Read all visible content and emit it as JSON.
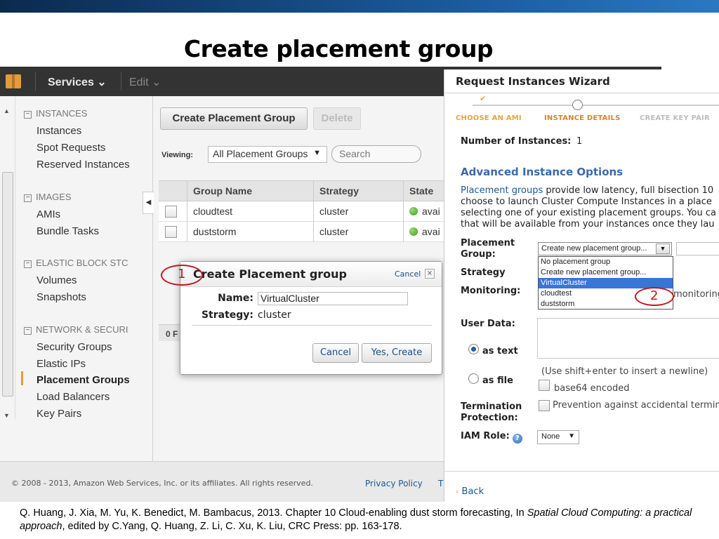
{
  "slide": {
    "title": "Create placement group",
    "citation": {
      "part1": "Q. Huang, J. Xia, M. Yu, K. Benedict, M. Bambacus, 2013. Chapter 10 Cloud-enabling dust storm forecasting, In ",
      "book": "Spatial Cloud Computing: a practical approach",
      "part2": ", edited by C.Yang, Q. Huang, Z. Li, C. Xu, K. Liu, CRC Press: pp. 163-178."
    }
  },
  "console": {
    "nav": {
      "services": "Services ⌄",
      "edit": "Edit ⌄"
    },
    "sidebar": {
      "sections": [
        {
          "heading": "INSTANCES",
          "items": [
            "Instances",
            "Spot Requests",
            "Reserved Instances"
          ]
        },
        {
          "heading": "IMAGES",
          "items": [
            "AMIs",
            "Bundle Tasks"
          ]
        },
        {
          "heading": "ELASTIC BLOCK STC",
          "items": [
            "Volumes",
            "Snapshots"
          ]
        },
        {
          "heading": "NETWORK & SECURI",
          "items": [
            "Security Groups",
            "Elastic IPs",
            "Placement Groups",
            "Load Balancers",
            "Key Pairs"
          ]
        }
      ]
    },
    "toolbar": {
      "create_label": "Create Placement Group",
      "delete_label": "Delete"
    },
    "viewing": {
      "label": "Viewing:",
      "selected": "All Placement Groups",
      "search_placeholder": "Search"
    },
    "table": {
      "columns": [
        "Group Name",
        "Strategy",
        "State"
      ],
      "rows": [
        {
          "name": "cloudtest",
          "strategy": "cluster",
          "state": "avai"
        },
        {
          "name": "duststorm",
          "strategy": "cluster",
          "state": "avai"
        }
      ],
      "count_label": "0 F"
    },
    "footer": {
      "copyright": "© 2008 - 2013, Amazon Web Services, Inc. or its affiliates. All rights reserved.",
      "privacy": "Privacy Policy",
      "terms": "T"
    }
  },
  "dialog": {
    "title": "Create Placement group",
    "cancel_link": "Cancel",
    "close": "×",
    "name_label": "Name:",
    "name_value": "VirtualCluster",
    "strategy_label": "Strategy:",
    "strategy_value": "cluster",
    "cancel_button": "Cancel",
    "confirm_button": "Yes, Create"
  },
  "annotations": {
    "one": "1",
    "two": "2"
  },
  "wizard": {
    "title": "Request Instances Wizard",
    "steps": [
      "CHOOSE AN AMI",
      "INSTANCE DETAILS",
      "CREATE KEY PAIR"
    ],
    "num_instances_label": "Number of Instances:",
    "num_instances_value": "1",
    "advanced_heading": "Advanced Instance Options",
    "description": {
      "link": "Placement groups",
      "line1": " provide low latency, full bisection 10",
      "line2": "choose to launch Cluster Compute Instances in a place",
      "line3": "selecting one of your existing placement groups. You ca",
      "line4": "that will be available from your instances once they lau"
    },
    "pg_label_1": "Placement",
    "pg_label_2": "Group:",
    "pg_selected": "Create new placement group...",
    "pg_options": [
      "No placement group",
      "Create new placement group...",
      "VirtualCluster",
      "cloudtest",
      "duststorm"
    ],
    "strategy_label": "Strategy",
    "monitoring_label": "Monitoring:",
    "monitoring_text": "monitoring",
    "user_data_label": "User Data:",
    "as_text": "as text",
    "as_file": "as file",
    "newline_hint": "(Use shift+enter to insert a newline)",
    "base64": "base64 encoded",
    "termination_label_1": "Termination",
    "termination_label_2": "Protection:",
    "termination_text": "Prevention against accidental terminati",
    "iam_label": "IAM Role:",
    "iam_value": "None",
    "back": "Back"
  },
  "colors": {
    "annotation": "#c0171d",
    "link": "#1a5a96",
    "accent": "#e29b3e",
    "heading_blue": "#3a6aa8"
  }
}
